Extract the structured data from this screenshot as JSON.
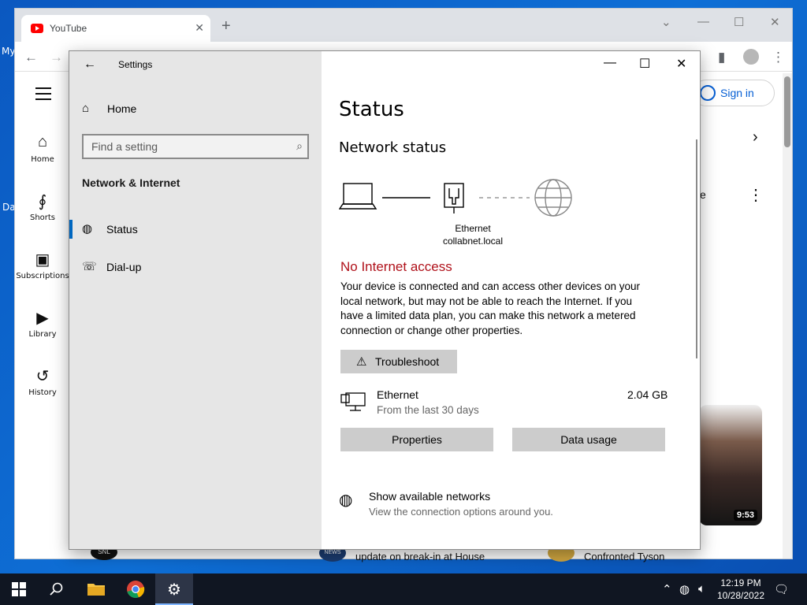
{
  "desktop": {
    "fragment_1": "My",
    "fragment_2": "Da"
  },
  "browser": {
    "tab_title": "YouTube",
    "sidebar": [
      {
        "label": "Home",
        "icon": "home-icon"
      },
      {
        "label": "Shorts",
        "icon": "shorts-icon"
      },
      {
        "label": "Subscriptions",
        "icon": "subscriptions-icon"
      },
      {
        "label": "Library",
        "icon": "library-icon"
      },
      {
        "label": "History",
        "icon": "history-icon"
      }
    ],
    "sign_in": "Sign in",
    "fragment_e": "e",
    "video_duration": "9:53",
    "bottom_text_1": "update on break-in at House",
    "bottom_text_2": "Confronted Tyson",
    "news_badge": "NEWS",
    "snl_badge": "SNL"
  },
  "settings": {
    "app_title": "Settings",
    "home_label": "Home",
    "search_placeholder": "Find a setting",
    "section_title": "Network & Internet",
    "nav": [
      {
        "label": "Status",
        "active": true,
        "icon": "globe-icon"
      },
      {
        "label": "Dial-up",
        "active": false,
        "icon": "dialup-icon"
      }
    ],
    "page_title": "Status",
    "network_status_heading": "Network status",
    "adapter_name": "Ethernet",
    "domain": "collabnet.local",
    "alert": "No Internet access",
    "alert_color": "#b0121b",
    "description": "Your device is connected and can access other devices on your local network, but may not be able to reach the Internet. If you have a limited data plan, you can make this network a metered connection or change other properties.",
    "troubleshoot_label": "Troubleshoot",
    "connection": {
      "name": "Ethernet",
      "subtitle": "From the last 30 days",
      "usage": "2.04 GB"
    },
    "properties_label": "Properties",
    "data_usage_label": "Data usage",
    "show_networks": "Show available networks",
    "show_networks_sub": "View the connection options around you."
  },
  "taskbar": {
    "time": "12:19 PM",
    "date": "10/28/2022",
    "accent": "#7fb5ff"
  }
}
